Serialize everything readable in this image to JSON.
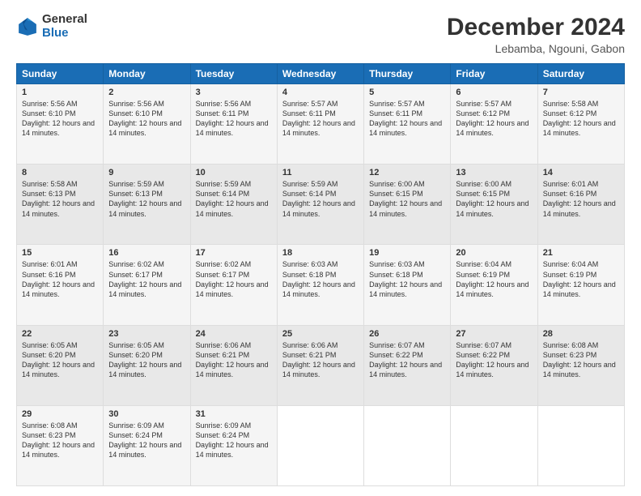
{
  "logo": {
    "general": "General",
    "blue": "Blue"
  },
  "title": "December 2024",
  "subtitle": "Lebamba, Ngouni, Gabon",
  "days_of_week": [
    "Sunday",
    "Monday",
    "Tuesday",
    "Wednesday",
    "Thursday",
    "Friday",
    "Saturday"
  ],
  "weeks": [
    [
      {
        "day": "1",
        "sunrise": "5:56 AM",
        "sunset": "6:10 PM",
        "daylight": "12 hours and 14 minutes."
      },
      {
        "day": "2",
        "sunrise": "5:56 AM",
        "sunset": "6:10 PM",
        "daylight": "12 hours and 14 minutes."
      },
      {
        "day": "3",
        "sunrise": "5:56 AM",
        "sunset": "6:11 PM",
        "daylight": "12 hours and 14 minutes."
      },
      {
        "day": "4",
        "sunrise": "5:57 AM",
        "sunset": "6:11 PM",
        "daylight": "12 hours and 14 minutes."
      },
      {
        "day": "5",
        "sunrise": "5:57 AM",
        "sunset": "6:11 PM",
        "daylight": "12 hours and 14 minutes."
      },
      {
        "day": "6",
        "sunrise": "5:57 AM",
        "sunset": "6:12 PM",
        "daylight": "12 hours and 14 minutes."
      },
      {
        "day": "7",
        "sunrise": "5:58 AM",
        "sunset": "6:12 PM",
        "daylight": "12 hours and 14 minutes."
      }
    ],
    [
      {
        "day": "8",
        "sunrise": "5:58 AM",
        "sunset": "6:13 PM",
        "daylight": "12 hours and 14 minutes."
      },
      {
        "day": "9",
        "sunrise": "5:59 AM",
        "sunset": "6:13 PM",
        "daylight": "12 hours and 14 minutes."
      },
      {
        "day": "10",
        "sunrise": "5:59 AM",
        "sunset": "6:14 PM",
        "daylight": "12 hours and 14 minutes."
      },
      {
        "day": "11",
        "sunrise": "5:59 AM",
        "sunset": "6:14 PM",
        "daylight": "12 hours and 14 minutes."
      },
      {
        "day": "12",
        "sunrise": "6:00 AM",
        "sunset": "6:15 PM",
        "daylight": "12 hours and 14 minutes."
      },
      {
        "day": "13",
        "sunrise": "6:00 AM",
        "sunset": "6:15 PM",
        "daylight": "12 hours and 14 minutes."
      },
      {
        "day": "14",
        "sunrise": "6:01 AM",
        "sunset": "6:16 PM",
        "daylight": "12 hours and 14 minutes."
      }
    ],
    [
      {
        "day": "15",
        "sunrise": "6:01 AM",
        "sunset": "6:16 PM",
        "daylight": "12 hours and 14 minutes."
      },
      {
        "day": "16",
        "sunrise": "6:02 AM",
        "sunset": "6:17 PM",
        "daylight": "12 hours and 14 minutes."
      },
      {
        "day": "17",
        "sunrise": "6:02 AM",
        "sunset": "6:17 PM",
        "daylight": "12 hours and 14 minutes."
      },
      {
        "day": "18",
        "sunrise": "6:03 AM",
        "sunset": "6:18 PM",
        "daylight": "12 hours and 14 minutes."
      },
      {
        "day": "19",
        "sunrise": "6:03 AM",
        "sunset": "6:18 PM",
        "daylight": "12 hours and 14 minutes."
      },
      {
        "day": "20",
        "sunrise": "6:04 AM",
        "sunset": "6:19 PM",
        "daylight": "12 hours and 14 minutes."
      },
      {
        "day": "21",
        "sunrise": "6:04 AM",
        "sunset": "6:19 PM",
        "daylight": "12 hours and 14 minutes."
      }
    ],
    [
      {
        "day": "22",
        "sunrise": "6:05 AM",
        "sunset": "6:20 PM",
        "daylight": "12 hours and 14 minutes."
      },
      {
        "day": "23",
        "sunrise": "6:05 AM",
        "sunset": "6:20 PM",
        "daylight": "12 hours and 14 minutes."
      },
      {
        "day": "24",
        "sunrise": "6:06 AM",
        "sunset": "6:21 PM",
        "daylight": "12 hours and 14 minutes."
      },
      {
        "day": "25",
        "sunrise": "6:06 AM",
        "sunset": "6:21 PM",
        "daylight": "12 hours and 14 minutes."
      },
      {
        "day": "26",
        "sunrise": "6:07 AM",
        "sunset": "6:22 PM",
        "daylight": "12 hours and 14 minutes."
      },
      {
        "day": "27",
        "sunrise": "6:07 AM",
        "sunset": "6:22 PM",
        "daylight": "12 hours and 14 minutes."
      },
      {
        "day": "28",
        "sunrise": "6:08 AM",
        "sunset": "6:23 PM",
        "daylight": "12 hours and 14 minutes."
      }
    ],
    [
      {
        "day": "29",
        "sunrise": "6:08 AM",
        "sunset": "6:23 PM",
        "daylight": "12 hours and 14 minutes."
      },
      {
        "day": "30",
        "sunrise": "6:09 AM",
        "sunset": "6:24 PM",
        "daylight": "12 hours and 14 minutes."
      },
      {
        "day": "31",
        "sunrise": "6:09 AM",
        "sunset": "6:24 PM",
        "daylight": "12 hours and 14 minutes."
      },
      null,
      null,
      null,
      null
    ]
  ],
  "sunrise_label": "Sunrise:",
  "sunset_label": "Sunset:",
  "daylight_label": "Daylight:"
}
